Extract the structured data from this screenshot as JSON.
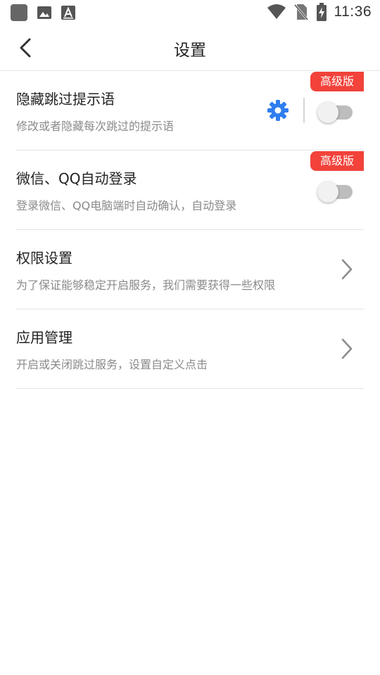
{
  "status_bar": {
    "time": "11:36",
    "icons": [
      "app-square-icon",
      "image-icon",
      "text-a-icon",
      "wifi-icon",
      "no-sim-icon",
      "battery-charging-icon"
    ]
  },
  "header": {
    "title": "设置",
    "back_icon": "chevron-left-icon"
  },
  "settings": [
    {
      "title": "隐藏跳过提示语",
      "subtitle": "修改或者隐藏每次跳过的提示语",
      "badge": "高级版",
      "control": "toggle",
      "enabled": false,
      "extra_icon": "gear-icon"
    },
    {
      "title": "微信、QQ自动登录",
      "subtitle": "登录微信、QQ电脑端时自动确认，自动登录",
      "badge": "高级版",
      "control": "toggle",
      "enabled": false
    },
    {
      "title": "权限设置",
      "subtitle": "为了保证能够稳定开启服务，我们需要获得一些权限",
      "control": "chevron"
    },
    {
      "title": "应用管理",
      "subtitle": "开启或关闭跳过服务，设置自定义点击",
      "control": "chevron"
    }
  ],
  "colors": {
    "badge_bg": "#f2423a",
    "gear": "#2f7df0",
    "toggle_track": "#bdbdbd",
    "divider": "#e3e3e3"
  }
}
